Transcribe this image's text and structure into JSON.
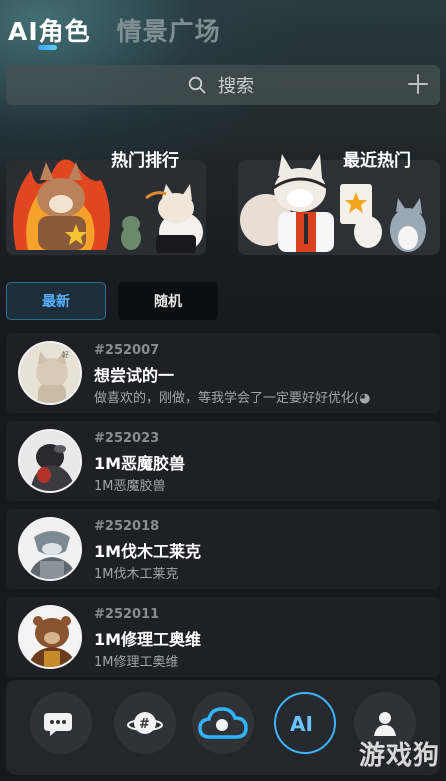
{
  "tabs": [
    {
      "label": "AI角色",
      "active": true
    },
    {
      "label": "情景广场",
      "active": false
    }
  ],
  "search": {
    "placeholder": "搜索"
  },
  "features": [
    {
      "title": "热门排行"
    },
    {
      "title": "最近热门"
    }
  ],
  "filters": [
    {
      "label": "最新",
      "active": true
    },
    {
      "label": "随机",
      "active": false
    }
  ],
  "characters": [
    {
      "id": "#252007",
      "name": "想尝试的一",
      "desc": "做喜欢的，刚做，等我学会了一定要好好优化(◕",
      "avatar_color": "#d9d4c8"
    },
    {
      "id": "#252023",
      "name": "1M恶魔胶兽",
      "desc": "1M恶魔胶兽",
      "avatar_color": "#3a3a3e"
    },
    {
      "id": "#252018",
      "name": "1M伐木工莱克",
      "desc": "1M伐木工莱克",
      "avatar_color": "#8b959c"
    },
    {
      "id": "#252011",
      "name": "1M修理工奥维",
      "desc": "1M修理工奥维",
      "avatar_color": "#7a4a2c"
    }
  ],
  "nav": [
    {
      "icon": "chat-bubbles-icon"
    },
    {
      "icon": "topic-planet-icon"
    },
    {
      "icon": "cloud-icon"
    },
    {
      "icon": "ai-icon",
      "label": "AI"
    },
    {
      "icon": "profile-icon"
    }
  ],
  "watermark": "游戏狗",
  "colors": {
    "accent": "#3da0ff",
    "background": "#16181c",
    "card": "#1e2024"
  }
}
